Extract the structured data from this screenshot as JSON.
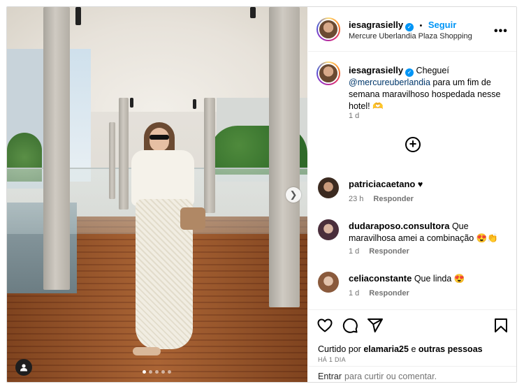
{
  "post": {
    "author": "iesagrasielly",
    "follow_label": "Seguir",
    "separator": "•",
    "location": "Mercure Uberlandia Plaza Shopping",
    "more_label": "•••"
  },
  "caption": {
    "author": "iesagrasielly",
    "text_start": "Chegueí",
    "mention": "@mercureuberlandia",
    "text_end": "para um fim de semana maravilhoso hospedada nesse hotel! 🫶",
    "time": "1 d"
  },
  "comments": [
    {
      "author": "patriciacaetano",
      "text": "♥",
      "time": "23 h",
      "reply": "Responder"
    },
    {
      "author": "dudaraposo.consultora",
      "text": "Que maravilhosa amei a combinação 😍👏",
      "time": "1 d",
      "reply": "Responder"
    },
    {
      "author": "celiaconstante",
      "text": "Que linda 😍",
      "time": "1 d",
      "reply": "Responder"
    }
  ],
  "likes": {
    "prefix": "Curtido por",
    "user": "elamaria25",
    "conjunction": "e",
    "others": "outras pessoas"
  },
  "post_date": "HÁ 1 DIA",
  "comment_box": {
    "enter_label": "Entrar",
    "placeholder": "para curtir ou comentar."
  },
  "carousel": {
    "current": 1,
    "total": 5
  },
  "icons": {
    "like": "heart-icon",
    "comment": "comment-icon",
    "share": "send-icon",
    "save": "bookmark-icon",
    "load_more": "plus-circle-icon",
    "next": "chevron-right-icon",
    "tags": "user-tag-icon"
  },
  "colors": {
    "accent": "#0095f6",
    "mention": "#00376b",
    "muted": "#737373"
  }
}
